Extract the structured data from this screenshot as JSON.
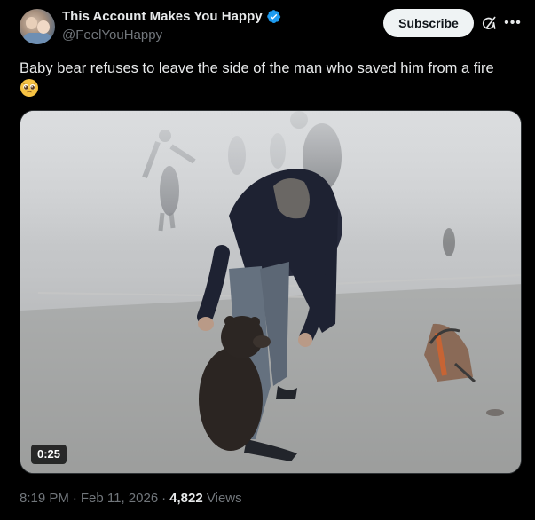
{
  "author": {
    "display_name": "This Account Makes You Happy",
    "handle": "@FeelYouHappy",
    "verified_icon": "verified-badge-icon",
    "avatar_icon": "avatar-photo"
  },
  "actions": {
    "subscribe_label": "Subscribe",
    "grok_icon": "grok-icon",
    "more_icon": "more-horizontal-icon"
  },
  "tweet": {
    "text": "Baby bear refuses to leave the side of the man who saved him from a fire",
    "emoji": "pleading-face-icon"
  },
  "media": {
    "type": "video",
    "duration": "0:25"
  },
  "meta": {
    "time": "8:19 PM",
    "separator": "·",
    "date": "Feb 11, 2026",
    "views_count": "4,822",
    "views_label": "Views"
  },
  "colors": {
    "background": "#000000",
    "text_primary": "#e7e9ea",
    "text_secondary": "#71767b",
    "verified_blue": "#1d9bf0",
    "subscribe_bg": "#eff3f4"
  }
}
